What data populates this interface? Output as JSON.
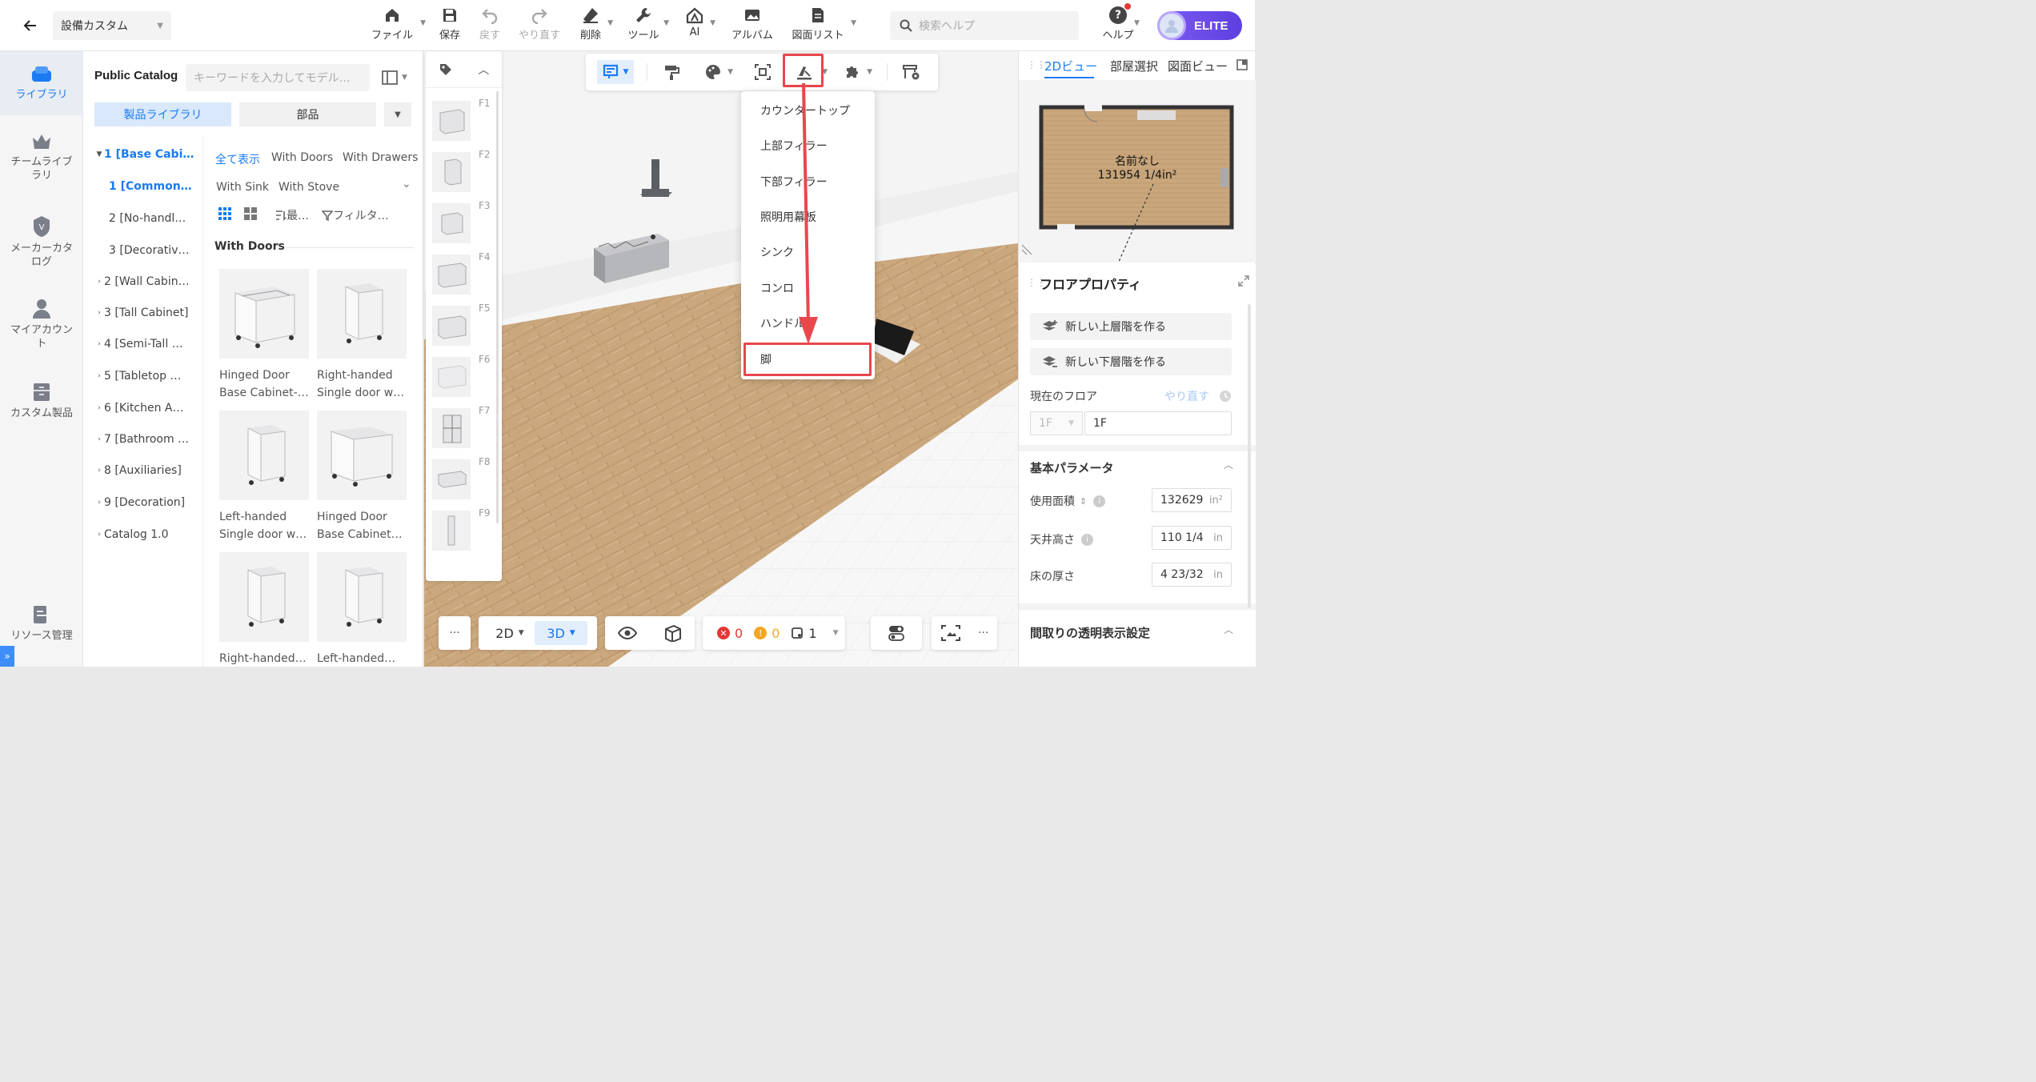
{
  "header": {
    "design_name": "設備カスタム",
    "tools": [
      {
        "label": "ファイル",
        "icon": "home-icon"
      },
      {
        "label": "保存",
        "icon": "save-icon"
      },
      {
        "label": "戻す",
        "icon": "undo-icon"
      },
      {
        "label": "やり直す",
        "icon": "redo-icon"
      },
      {
        "label": "削除",
        "icon": "eraser-icon"
      },
      {
        "label": "ツール",
        "icon": "wrench-icon"
      },
      {
        "label": "AI",
        "icon": "ai-house-icon"
      },
      {
        "label": "アルバム",
        "icon": "image-icon"
      },
      {
        "label": "図面リスト",
        "icon": "document-icon"
      }
    ],
    "search_placeholder": "検索ヘルプ",
    "help_label": "ヘルプ",
    "badge": "ELITE"
  },
  "leftnav": {
    "items": [
      {
        "label": "ライブラリ",
        "active": true
      },
      {
        "label": "チームライブラリ",
        "active": false
      },
      {
        "label": "メーカーカタログ",
        "active": false
      },
      {
        "label": "マイアカウント",
        "active": false
      },
      {
        "label": "カスタム製品",
        "active": false
      },
      {
        "label": "リソース管理",
        "active": false
      }
    ]
  },
  "catalog": {
    "title": "Public Catalog",
    "search_placeholder": "キーワードを入力してモデル…",
    "tabs": {
      "product_library": "製品ライブラリ",
      "parts": "部品"
    },
    "tree": [
      {
        "label": "1 [Base Cabi…",
        "level": 0,
        "expanded": true,
        "selected": true
      },
      {
        "label": "1 [Common…",
        "level": 1,
        "selected": true
      },
      {
        "label": "2 [No-handl…",
        "level": 1
      },
      {
        "label": "3 [Decorativ…",
        "level": 1
      },
      {
        "label": "2 [Wall Cabin…",
        "level": 0
      },
      {
        "label": "3 [Tall Cabinet]",
        "level": 0
      },
      {
        "label": "4 [Semi-Tall …",
        "level": 0
      },
      {
        "label": "5 [Tabletop …",
        "level": 0
      },
      {
        "label": "6 [Kitchen A…",
        "level": 0
      },
      {
        "label": "7 [Bathroom …",
        "level": 0
      },
      {
        "label": "8 [Auxiliaries]",
        "level": 0
      },
      {
        "label": "9 [Decoration]",
        "level": 0
      },
      {
        "label": "Catalog 1.0",
        "level": 0
      }
    ],
    "filters": [
      "全て表示",
      "With Doors",
      "With Drawers",
      "With Sink",
      "With Stove"
    ],
    "sort_label": "最…",
    "filter_label": "フィルタ…",
    "section_title": "With Doors",
    "products": [
      {
        "name": "Hinged Door Base Cabinet-…"
      },
      {
        "name": "Right-handed Single door w…"
      },
      {
        "name": "Left-handed Single door w…"
      },
      {
        "name": "Hinged Door Base Cabinet…"
      },
      {
        "name": "Right-handed…"
      },
      {
        "name": "Left-handed…"
      }
    ]
  },
  "thumbs": [
    "F1",
    "F2",
    "F3",
    "F4",
    "F5",
    "F6",
    "F7",
    "F8",
    "F9"
  ],
  "dropdown": {
    "items": [
      "カウンタートップ",
      "上部フィラー",
      "下部フィラー",
      "照明用幕板",
      "シンク",
      "コンロ",
      "ハンドル",
      "脚"
    ],
    "highlighted": "脚"
  },
  "rightpanel": {
    "tabs": [
      "2Dビュー",
      "部屋選択",
      "図面ビュー"
    ],
    "room_name": "名前なし",
    "room_area": "131954 1/4in²",
    "floor_title": "フロアプロパティ",
    "btn_upper": "新しい上層階を作る",
    "btn_lower": "新しい下層階を作る",
    "current_floor_label": "現在のフロア",
    "redo_label": "やり直す",
    "floor_select": "1F",
    "floor_value": "1F",
    "basic_params": "基本パラメータ",
    "area_label": "使用面積",
    "area_value": "132629",
    "area_unit": "in²",
    "ceiling_label": "天井高さ",
    "ceiling_value": "110 1/4",
    "ceiling_unit": "in",
    "floor_thick_label": "床の厚さ",
    "floor_thick_value": "4 23/32",
    "floor_thick_unit": "in",
    "transparency_title": "間取りの透明表示設定"
  },
  "bottombar": {
    "more": "···",
    "mode_2d": "2D",
    "mode_3d": "3D",
    "errors": "0",
    "warnings": "0",
    "count": "1"
  },
  "colors": {
    "accent": "#1a7bf2",
    "highlight": "#e8474c",
    "floor_wood": "#c9a67c"
  }
}
